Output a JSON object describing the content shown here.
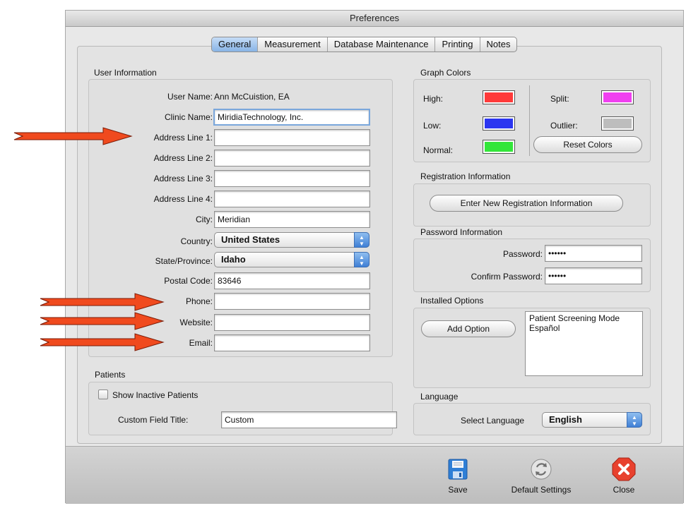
{
  "window": {
    "title": "Preferences"
  },
  "tabs": [
    "General",
    "Measurement",
    "Database Maintenance",
    "Printing",
    "Notes"
  ],
  "user_info": {
    "title": "User Information",
    "user_name_label": "User Name:",
    "user_name_value": "Ann McCuistion, EA",
    "clinic_name_label": "Clinic Name:",
    "clinic_name_value": "MiridiaTechnology, Inc.",
    "address1_label": "Address Line 1:",
    "address1_value": "",
    "address2_label": "Address Line 2:",
    "address2_value": "",
    "address3_label": "Address Line 3:",
    "address3_value": "",
    "address4_label": "Address Line 4:",
    "address4_value": "",
    "city_label": "City:",
    "city_value": "Meridian",
    "country_label": "Country:",
    "country_value": "United States",
    "state_label": "State/Province:",
    "state_value": "Idaho",
    "postal_label": "Postal Code:",
    "postal_value": "83646",
    "phone_label": "Phone:",
    "phone_value": "",
    "website_label": "Website:",
    "website_value": "",
    "email_label": "Email:",
    "email_value": ""
  },
  "patients": {
    "title": "Patients",
    "show_inactive_label": "Show Inactive Patients",
    "show_inactive_checked": false,
    "custom_field_label": "Custom Field Title:",
    "custom_field_value": "Custom"
  },
  "graph_colors": {
    "title": "Graph Colors",
    "high_label": "High:",
    "high_color": "#ff3a3a",
    "low_label": "Low:",
    "low_color": "#2b35f0",
    "normal_label": "Normal:",
    "normal_color": "#33e63a",
    "split_label": "Split:",
    "split_color": "#f03ff0",
    "outlier_label": "Outlier:",
    "outlier_color": "#bdbdbd",
    "reset_label": "Reset Colors"
  },
  "registration": {
    "title": "Registration Information",
    "button_label": "Enter New Registration Information"
  },
  "password": {
    "title": "Password Information",
    "password_label": "Password:",
    "password_value": "••••••",
    "confirm_label": "Confirm Password:",
    "confirm_value": "••••••"
  },
  "installed_options": {
    "title": "Installed Options",
    "add_label": "Add Option",
    "items": [
      "Patient Screening Mode",
      "Español"
    ]
  },
  "language": {
    "title": "Language",
    "select_label": "Select Language",
    "value": "English"
  },
  "toolbar": {
    "save_label": "Save",
    "default_label": "Default Settings",
    "close_label": "Close"
  },
  "colors": {
    "arrow": "#f04a1e",
    "tab_active": "#88b4e6"
  }
}
